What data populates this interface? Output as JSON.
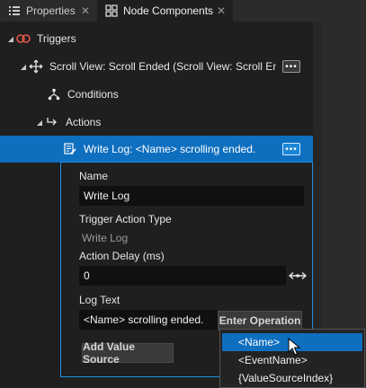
{
  "tabs": [
    {
      "label": "Properties",
      "icon": "list-icon",
      "active": false
    },
    {
      "label": "Node Components",
      "icon": "component-icon",
      "active": true
    }
  ],
  "tree": {
    "triggers_label": "Triggers",
    "scroll_node_label": "Scroll View: Scroll Ended (Scroll View: Scroll End",
    "conditions_label": "Conditions",
    "actions_label": "Actions",
    "write_log_label": "Write Log: <Name> scrolling ended.",
    "more_glyph": "•••"
  },
  "details": {
    "name_label": "Name",
    "name_value": "Write Log",
    "type_label": "Trigger Action Type",
    "type_value": "Write Log",
    "delay_label": "Action Delay (ms)",
    "delay_value": "0",
    "logtext_label": "Log Text",
    "logtext_value": "<Name> scrolling ended.",
    "enter_operation_label": "Enter Operation",
    "add_value_source_label": "Add Value Source"
  },
  "dropdown": {
    "items": [
      {
        "label": "<Name>",
        "selected": true
      },
      {
        "label": "<EventName>",
        "selected": false
      },
      {
        "label": "{ValueSourceIndex}",
        "selected": false
      }
    ]
  },
  "colors": {
    "accent": "#0f6fbf",
    "panel_bg": "#1f1f1f",
    "trigger_icon": "#e0564a"
  }
}
